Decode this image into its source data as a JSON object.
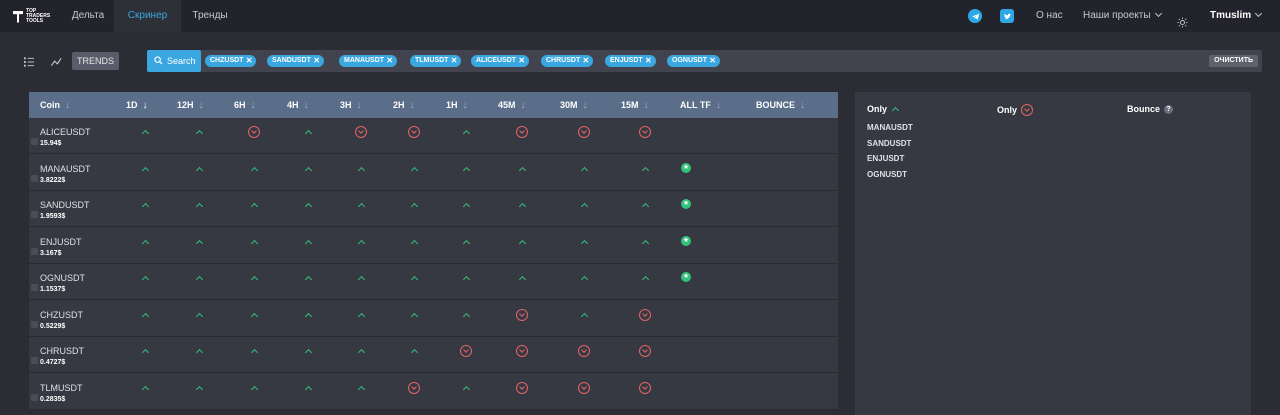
{
  "header": {
    "logo_text": "TOP\nTRADERS\nTOOLS",
    "tabs": [
      {
        "label": "Дельта"
      },
      {
        "label": "Скринер"
      },
      {
        "label": "Тренды"
      }
    ],
    "about_label": "О нас",
    "projects_label": "Наши проекты",
    "username": "Tmuslim"
  },
  "toolbar": {
    "trends_label": "TRENDS",
    "search_label": "Search",
    "chips": [
      "CHZUSDT",
      "SANDUSDT",
      "MANAUSDT",
      "TLMUSDT",
      "ALICEUSDT",
      "CHRUSDT",
      "ENJUSDT",
      "OGNUSDT"
    ],
    "clear_label": "ОЧИСТИТЬ"
  },
  "table": {
    "columns": [
      "Coin",
      "1D",
      "12H",
      "6H",
      "4H",
      "3H",
      "2H",
      "1H",
      "45M",
      "30M",
      "15M",
      "ALL TF",
      "BOUNCE"
    ],
    "active_sort": "1D",
    "timeframes": [
      "1D",
      "12H",
      "6H",
      "4H",
      "3H",
      "2H",
      "1H",
      "45M",
      "30M",
      "15M"
    ],
    "rows": [
      {
        "coin": "ALICEUSDT",
        "price": "15.94$",
        "trends": [
          "up",
          "up",
          "down",
          "up",
          "down",
          "down",
          "up",
          "down",
          "down",
          "down"
        ],
        "all_tf": false
      },
      {
        "coin": "MANAUSDT",
        "price": "3.8222$",
        "trends": [
          "up",
          "up",
          "up",
          "up",
          "up",
          "up",
          "up",
          "up",
          "up",
          "up"
        ],
        "all_tf": true
      },
      {
        "coin": "SANDUSDT",
        "price": "1.9593$",
        "trends": [
          "up",
          "up",
          "up",
          "up",
          "up",
          "up",
          "up",
          "up",
          "up",
          "up"
        ],
        "all_tf": true
      },
      {
        "coin": "ENJUSDT",
        "price": "3.167$",
        "trends": [
          "up",
          "up",
          "up",
          "up",
          "up",
          "up",
          "up",
          "up",
          "up",
          "up"
        ],
        "all_tf": true
      },
      {
        "coin": "OGNUSDT",
        "price": "1.1537$",
        "trends": [
          "up",
          "up",
          "up",
          "up",
          "up",
          "up",
          "up",
          "up",
          "up",
          "up"
        ],
        "all_tf": true
      },
      {
        "coin": "CHZUSDT",
        "price": "0.5229$",
        "trends": [
          "up",
          "up",
          "up",
          "up",
          "up",
          "up",
          "up",
          "down",
          "up",
          "down"
        ],
        "all_tf": false
      },
      {
        "coin": "CHRUSDT",
        "price": "0.4727$",
        "trends": [
          "up",
          "up",
          "up",
          "up",
          "up",
          "up",
          "down",
          "down",
          "down",
          "down"
        ],
        "all_tf": false
      },
      {
        "coin": "TLMUSDT",
        "price": "0.2835$",
        "trends": [
          "up",
          "up",
          "up",
          "up",
          "up",
          "down",
          "up",
          "down",
          "down",
          "down"
        ],
        "all_tf": false
      }
    ]
  },
  "summary": {
    "only_up_label": "Only",
    "only_down_label": "Only",
    "bounce_label": "Bounce",
    "only_up_items": [
      "MANAUSDT",
      "SANDUSDT",
      "ENJUSDT",
      "OGNUSDT"
    ]
  },
  "colors": {
    "accent": "#3aa7e0",
    "up": "#33c27a",
    "down": "#e26664",
    "header_row": "#5b6e89"
  }
}
